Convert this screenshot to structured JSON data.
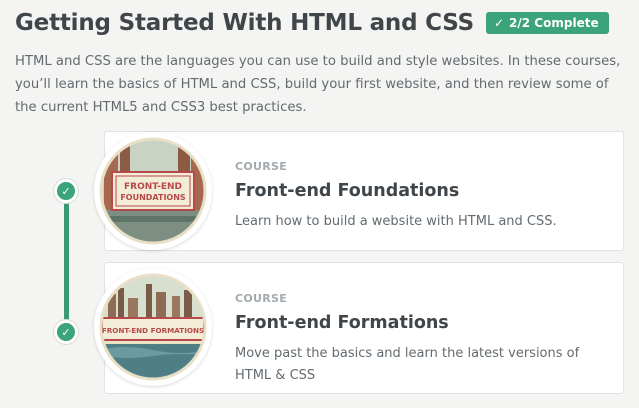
{
  "header": {
    "title": "Getting Started With HTML and CSS",
    "badge_label": "2/2 Complete",
    "badge_icon": "check-icon",
    "badge_color": "#3ca47a"
  },
  "intro": "HTML and CSS are the languages you can use to build and style websites. In these courses, you’ll learn the basics of HTML and CSS, build your first website, and then review some of the current HTML5 and CSS3 best practices.",
  "courses": [
    {
      "eyebrow": "COURSE",
      "title": "Front-end Foundations",
      "description": "Learn how to build a website with HTML and CSS.",
      "badge_line1": "FRONT-END",
      "badge_line2": "FOUNDATIONS",
      "completed": true
    },
    {
      "eyebrow": "COURSE",
      "title": "Front-end Formations",
      "description": "Move past the basics and learn the latest versions of HTML & CSS",
      "badge_line1": "FRONT-END FORMATIONS",
      "completed": true
    }
  ],
  "colors": {
    "accent": "#3ca47a",
    "timeline": "#3a9a76",
    "title": "#3f4549",
    "body_text": "#636b70",
    "background": "#f4f4f3"
  }
}
